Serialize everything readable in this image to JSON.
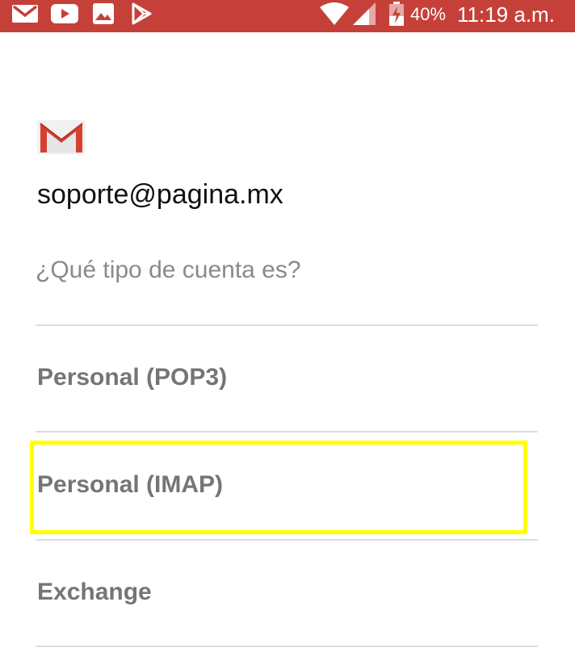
{
  "status_bar": {
    "background": "#c6403a",
    "icons": [
      "gmail-icon",
      "youtube-icon",
      "photos-icon",
      "play-store-icon",
      "wifi-icon",
      "signal-icon",
      "battery-charging-icon"
    ],
    "battery": "40%",
    "time": "11:19 a.m."
  },
  "account": {
    "logo": "gmail-logo-icon",
    "email": "soporte@pagina.mx"
  },
  "question": "¿Qué tipo de cuenta es?",
  "options": [
    {
      "label": "Personal (POP3)"
    },
    {
      "label": "Personal (IMAP)",
      "highlighted": true
    },
    {
      "label": "Exchange"
    }
  ],
  "highlight_color": "#ffff00"
}
